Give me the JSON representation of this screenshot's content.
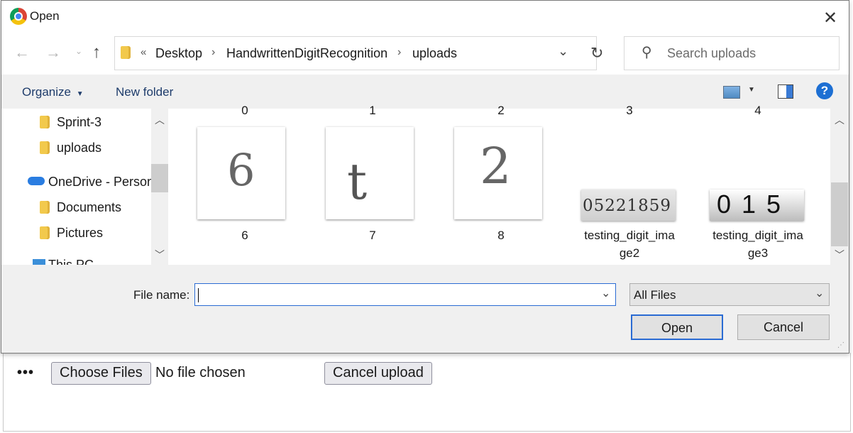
{
  "dialog": {
    "title": "Open",
    "address": {
      "prefix": "«",
      "crumbs": [
        "Desktop",
        "HandwrittenDigitRecognition",
        "uploads"
      ]
    },
    "search_placeholder": "Search uploads",
    "toolbar": {
      "organize": "Organize",
      "new_folder": "New folder",
      "help": "?"
    },
    "nav_pane": {
      "items": [
        "Sprint-3",
        "uploads",
        "OneDrive - Person",
        "Documents",
        "Pictures",
        "This PC"
      ]
    },
    "files_top_row": [
      "0",
      "1",
      "2",
      "3",
      "4"
    ],
    "files": [
      {
        "label": "6",
        "thumb_text": "6"
      },
      {
        "label": "7",
        "thumb_text": "t"
      },
      {
        "label": "8",
        "thumb_text": "2"
      },
      {
        "label_line1": "testing_digit_ima",
        "label_line2": "ge2",
        "thumb_text": "05221859"
      },
      {
        "label_line1": "testing_digit_ima",
        "label_line2": "ge3",
        "thumb_text": "015"
      }
    ],
    "file_name_label": "File name:",
    "file_name_value": "",
    "file_type": "All Files",
    "open_button": "Open",
    "cancel_button": "Cancel"
  },
  "page": {
    "more": "•••",
    "choose_files": "Choose Files",
    "no_file": "No file chosen",
    "cancel_upload": "Cancel upload"
  }
}
